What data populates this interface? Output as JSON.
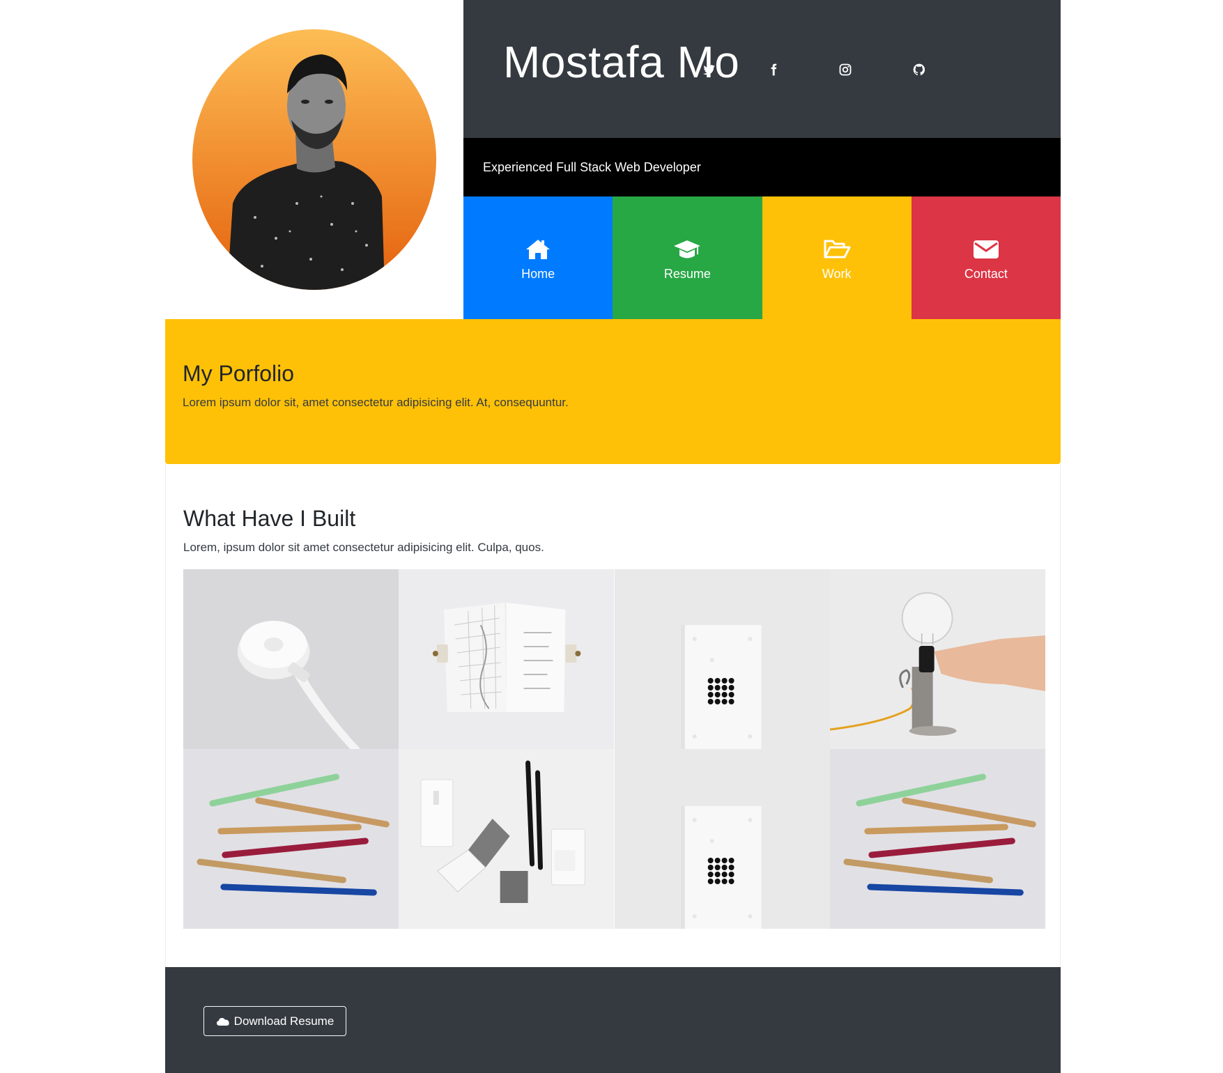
{
  "header": {
    "name": "Mostafa Mo",
    "tagline": "Experienced Full Stack Web Developer",
    "social": [
      {
        "icon": "twitter-icon"
      },
      {
        "icon": "facebook-icon"
      },
      {
        "icon": "instagram-icon"
      },
      {
        "icon": "github-icon"
      }
    ]
  },
  "nav": {
    "items": [
      {
        "label": "Home",
        "icon": "home-icon",
        "color": "#007bff"
      },
      {
        "label": "Resume",
        "icon": "graduation-cap-icon",
        "color": "#28a745"
      },
      {
        "label": "Work",
        "icon": "folder-open-icon",
        "color": "#ffc107"
      },
      {
        "label": "Contact",
        "icon": "envelope-icon",
        "color": "#dc3545"
      }
    ]
  },
  "portfolio": {
    "title": "My Porfolio",
    "text": "Lorem ipsum dolor sit, amet consectetur adipisicing elit. At, consequuntur."
  },
  "built": {
    "title": "What Have I Built",
    "text": "Lorem, ipsum dolor sit amet consectetur adipisicing elit. Culpa, quos.",
    "images": [
      {
        "name": "watch-charger-image"
      },
      {
        "name": "map-booklet-image"
      },
      {
        "name": "dotted-card-image"
      },
      {
        "name": "light-bulb-lamp-image"
      },
      {
        "name": "colored-pencils-image"
      },
      {
        "name": "stationery-set-image"
      },
      {
        "name": "dotted-card-image-2"
      },
      {
        "name": "colored-pencils-image-2"
      }
    ]
  },
  "footer": {
    "download_label": "Download Resume",
    "download_icon": "cloud-icon"
  },
  "colors": {
    "dark": "#343a40",
    "black": "#000000",
    "primary": "#007bff",
    "success": "#28a745",
    "warning": "#ffc107",
    "danger": "#dc3545"
  }
}
